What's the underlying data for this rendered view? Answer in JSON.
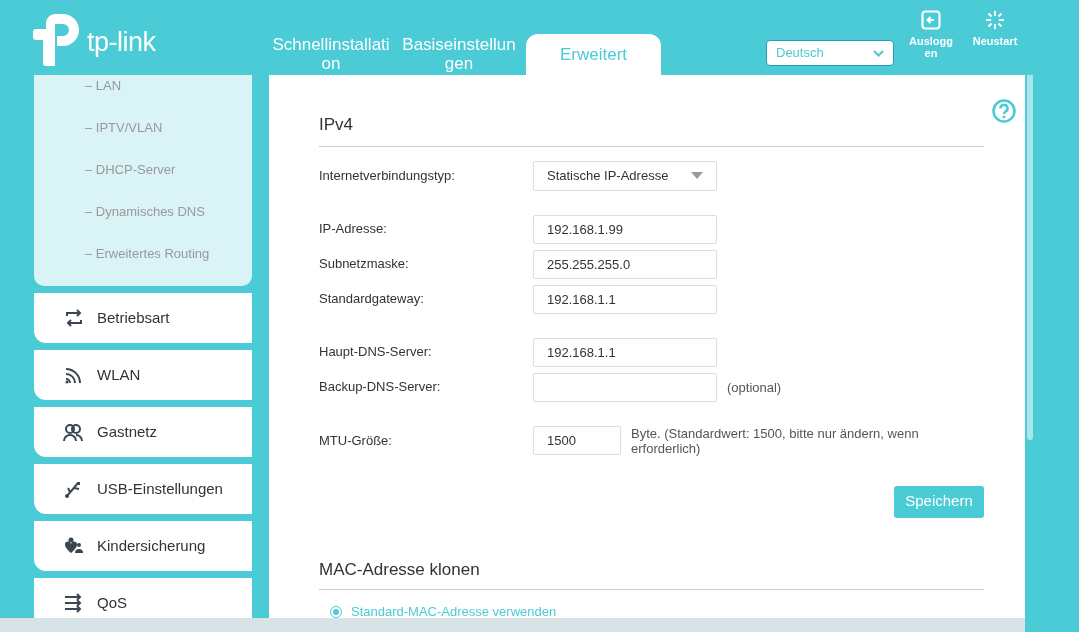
{
  "header": {
    "logo": "tp-link",
    "tabs": [
      {
        "label": "Schnellinstallation",
        "selected": false
      },
      {
        "label": "Basiseinstellungen",
        "selected": false
      },
      {
        "label": "Erweitert",
        "selected": true
      }
    ],
    "language": {
      "value": "Deutsch"
    },
    "actions": [
      {
        "kind": "logout",
        "label": "Ausloggen"
      },
      {
        "kind": "restart",
        "label": "Neustart"
      }
    ]
  },
  "sidebar": {
    "submenu": [
      "– LAN",
      "– IPTV/VLAN",
      "– DHCP-Server",
      "– Dynamisches DNS",
      "– Erweitertes Routing"
    ],
    "items": [
      {
        "label": "Betriebsart"
      },
      {
        "label": "WLAN"
      },
      {
        "label": "Gastnetz"
      },
      {
        "label": "USB-Einstellungen"
      },
      {
        "label": "Kindersicherung"
      },
      {
        "label": "QoS"
      }
    ]
  },
  "ipv4": {
    "title": "IPv4",
    "groups": [
      [
        {
          "kind": "select",
          "label": "Internetverbindungstyp:",
          "value": "Statische IP-Adresse"
        }
      ],
      [
        {
          "kind": "input",
          "label": "IP-Adresse:",
          "value": "192.168.1.99"
        },
        {
          "kind": "input",
          "label": "Subnetzmaske:",
          "value": "255.255.255.0"
        },
        {
          "kind": "input",
          "label": "Standardgateway:",
          "value": "192.168.1.1"
        }
      ],
      [
        {
          "kind": "input",
          "label": "Haupt-DNS-Server:",
          "value": "192.168.1.1"
        },
        {
          "kind": "input",
          "label": "Backup-DNS-Server:",
          "note": "(optional)"
        }
      ],
      [
        {
          "kind": "short",
          "label": "MTU-Größe:",
          "value": "1500",
          "note": "Byte. (Standardwert: 1500, bitte nur ändern, wenn erforderlich)"
        }
      ]
    ],
    "save": "Speichern"
  },
  "mac": {
    "title": "MAC-Adresse klonen",
    "options": [
      {
        "label": "Standard-MAC-Adresse verwenden",
        "selected": true
      }
    ]
  }
}
